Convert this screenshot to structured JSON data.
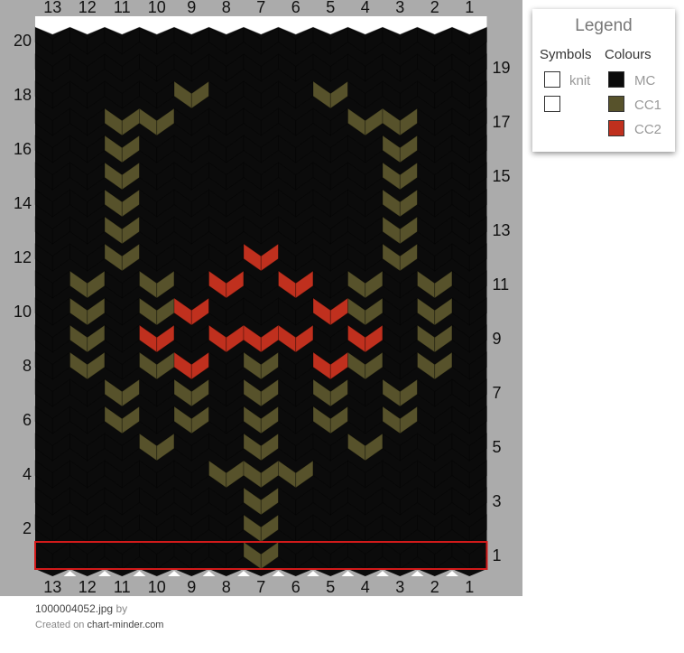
{
  "columns": [
    "13",
    "12",
    "11",
    "10",
    "9",
    "8",
    "7",
    "6",
    "5",
    "4",
    "3",
    "2",
    "1"
  ],
  "rows_left": [
    "20",
    "18",
    "16",
    "14",
    "12",
    "10",
    "8",
    "6",
    "4",
    "2"
  ],
  "rows_right": [
    "19",
    "17",
    "15",
    "13",
    "11",
    "9",
    "7",
    "5",
    "3",
    "1"
  ],
  "colors": {
    "MC": "#0b0b0b",
    "CC1": "#57522b",
    "CC2": "#c0301e",
    "highlight": "#d21a1a"
  },
  "grid_rows": [
    "MMMMMMMMMMMMM",
    "MMMMMMMMMMMMM",
    "MMMMAMMMAMMMM",
    "MMAAMMMMMAAMM",
    "MMAMMMMMMMAMM",
    "MMAMMMMMMMAMM",
    "MMAMMMMMMMAMM",
    "MMAMMMMMMMAMM",
    "MMAMMMBMMMAMM",
    "MAMAMBMBMAMAM",
    "MAMABMMMBAMAM",
    "MAMBMBBBMBMAM",
    "MAMAB MAMBAMAM",
    "MMAMAMAMAMAMM",
    "MMAMAMAMAMAMM",
    "MMMAMMAMMAMMM",
    "MMMMMAAAMMMMM",
    "MMMMMMAMMMMMM",
    "MMMMMMAMMMMMM",
    "MMMMMMAMMMMMM"
  ],
  "legend": {
    "title": "Legend",
    "symbols_header": "Symbols",
    "colours_header": "Colours",
    "symbols": [
      {
        "label": "knit"
      },
      {
        "label": ""
      }
    ],
    "colours": [
      {
        "label": "MC",
        "color": "#0b0b0b"
      },
      {
        "label": "CC1",
        "color": "#57522b"
      },
      {
        "label": "CC2",
        "color": "#c0301e"
      }
    ]
  },
  "footer": {
    "filename": "1000004052.jpg",
    "by": "by",
    "created_on": "Created on",
    "site": "chart-minder.com"
  }
}
